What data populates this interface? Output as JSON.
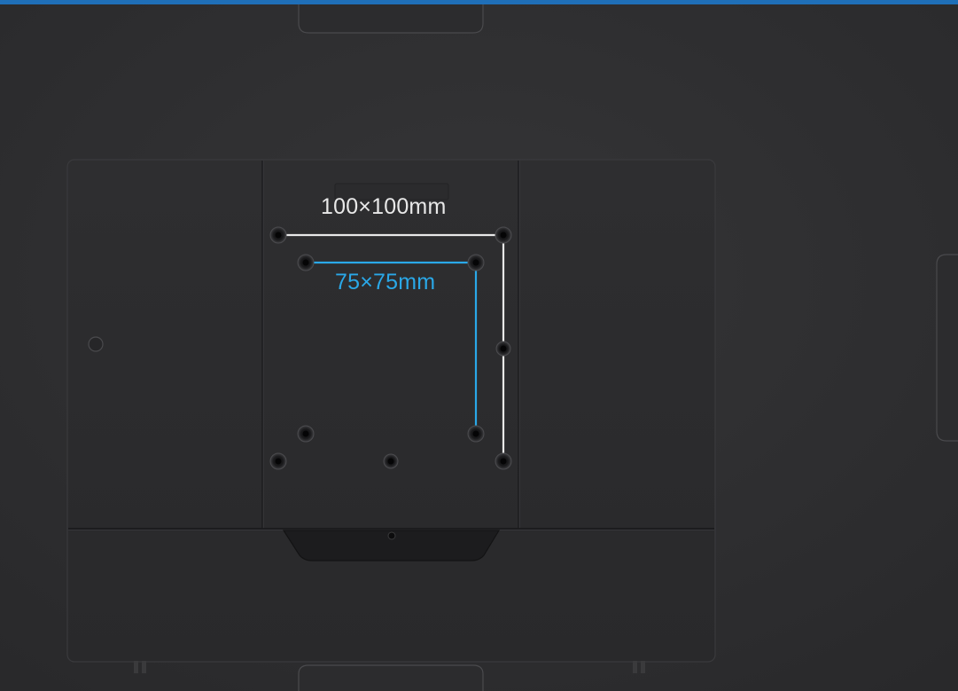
{
  "labels": {
    "large_pattern": "100×100mm",
    "small_pattern": "75×75mm"
  },
  "colors": {
    "background": "#2f2f31",
    "panel": "#2b2b2d",
    "top_edge": "#1f6fb8",
    "large_pattern": "#e8e8e8",
    "small_pattern": "#2aa8e8"
  },
  "icons": {
    "screw_hole": "screw-hole-icon",
    "button": "round-button-icon"
  }
}
